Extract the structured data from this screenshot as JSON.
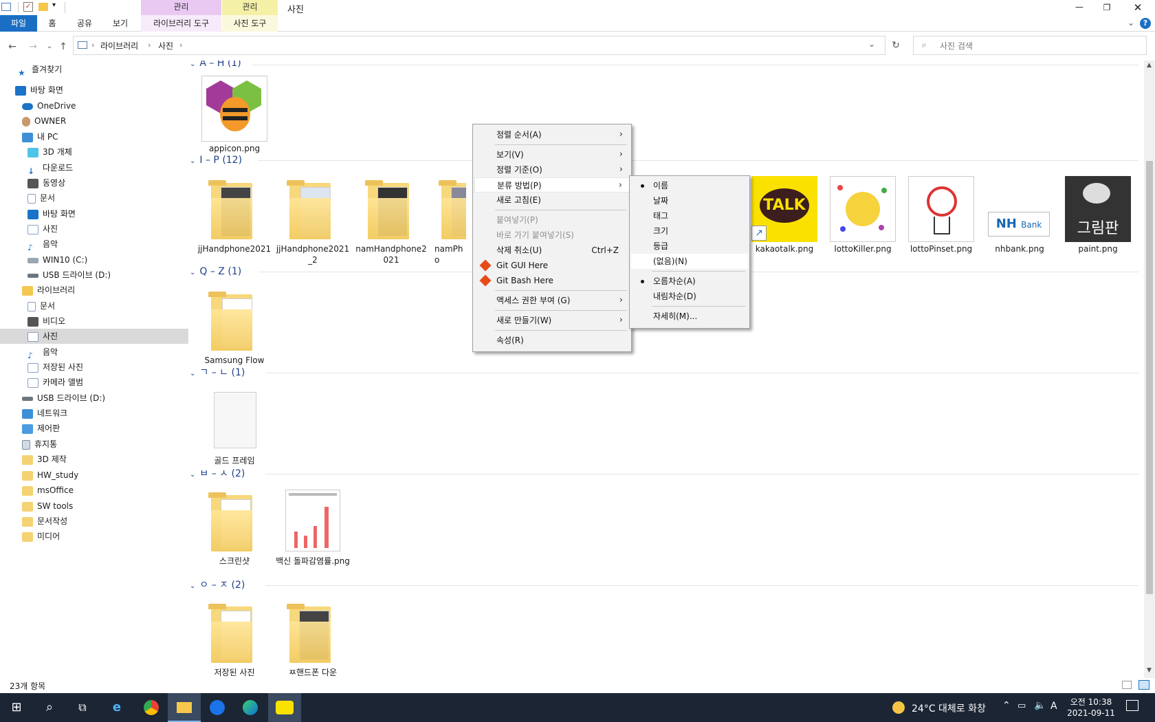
{
  "titlebar": {
    "context_tab_1": "관리",
    "context_tab_2": "관리",
    "window_title": "사진"
  },
  "ribbon": {
    "tabs": [
      "파일",
      "홈",
      "공유",
      "보기",
      "라이브러리 도구",
      "사진 도구"
    ]
  },
  "address": {
    "crumbs": [
      "라이브러리",
      "사진"
    ],
    "search_placeholder": "사진 검색"
  },
  "sidebar": {
    "items": [
      "즐겨찾기",
      "바탕 화면",
      "OneDrive",
      "OWNER",
      "내 PC",
      "3D 개체",
      "다운로드",
      "동영상",
      "문서",
      "바탕 화면",
      "사진",
      "음악",
      "WIN10 (C:)",
      "USB 드라이브 (D:)",
      "라이브러리",
      "문서",
      "비디오",
      "사진",
      "음악",
      "저장된 사진",
      "카메라 앨범",
      "USB 드라이브 (D:)",
      "네트워크",
      "제어판",
      "휴지통",
      "3D 제작",
      "HW_study",
      "msOffice",
      "SW tools",
      "문서작성",
      "미디어"
    ]
  },
  "groups": [
    {
      "header": "A – H (1)"
    },
    {
      "header": "I – P (12)"
    },
    {
      "header": "Q – Z (1)"
    },
    {
      "header": "ㄱ – ㄴ (1)"
    },
    {
      "header": "ㅂ – ㅅ (2)"
    },
    {
      "header": "ㅇ – ㅈ (2)"
    }
  ],
  "files": {
    "a_h": [
      "appicon.png"
    ],
    "i_p": [
      "jjHandphone2021",
      "jjHandphone2021_2",
      "namHandphone2021",
      "namPho",
      "kakaotalk.png",
      "lottoKiller.png",
      "lottoPinset.png",
      "nhbank.png",
      "paint.png"
    ],
    "q_z": [
      "Samsung Flow"
    ],
    "ga": [
      "골드 프레임"
    ],
    "bs": [
      "스크린샷",
      "백신 돌파감염률.png"
    ],
    "oj": [
      "저장된 사진",
      "ㅉ핸드폰 다운"
    ]
  },
  "thumb_text": {
    "talk": "TALK",
    "nh": "NH",
    "nh_bank": "Bank",
    "paint": "그림판"
  },
  "context_menu": {
    "items": [
      "정렬 순서(A)",
      "보기(V)",
      "정렬 기준(O)",
      "분류 방법(P)",
      "새로 고침(E)",
      "붙여넣기(P)",
      "바로 가기 붙여넣기(S)",
      "삭제 취소(U)",
      "Git GUI Here",
      "Git Bash Here",
      "액세스 권한 부여 (G)",
      "새로 만들기(W)",
      "속성(R)"
    ],
    "shortcut_undo": "Ctrl+Z"
  },
  "submenu": {
    "items": [
      "이름",
      "날짜",
      "태그",
      "크기",
      "등급",
      "(없음)(N)",
      "오름차순(A)",
      "내림차순(D)",
      "자세히(M)..."
    ]
  },
  "status": {
    "count": "23개 항목"
  },
  "taskbar": {
    "weather": "24°C  대체로 화창",
    "time": "오전 10:38",
    "date": "2021-09-11",
    "ime": "A"
  }
}
